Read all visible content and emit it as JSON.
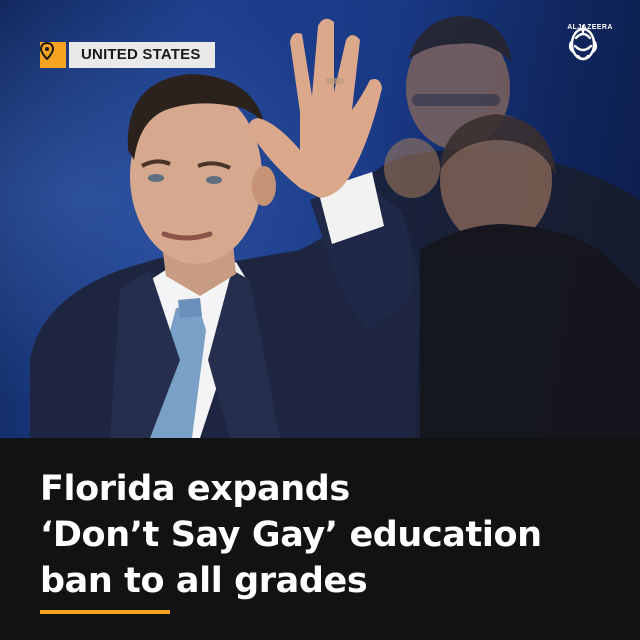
{
  "tag": {
    "label": "UNITED STATES",
    "icon": "location-pin-icon"
  },
  "logo": {
    "wordmark": "ALJAZEERA",
    "icon": "al-jazeera-calligraphy-logo"
  },
  "headline": {
    "lines": [
      "Florida expands",
      "‘Don’t Say Gay’ education",
      "ban to all grades"
    ]
  },
  "colors": {
    "accent": "#f5a321",
    "band": "#121212",
    "headline_text": "#ffffff",
    "tag_bg": "#e9e9e9"
  }
}
